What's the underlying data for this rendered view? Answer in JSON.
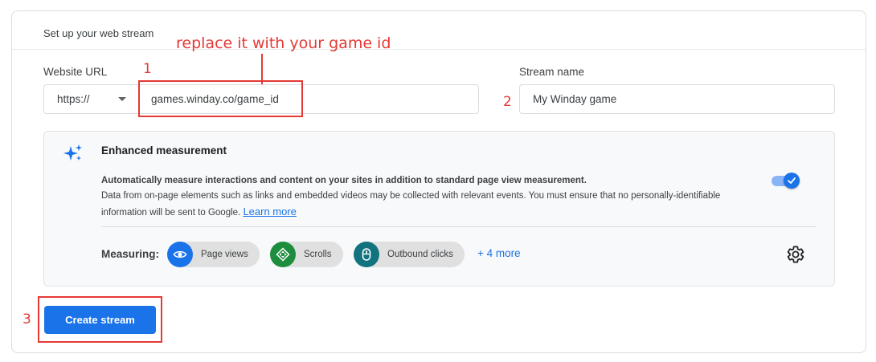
{
  "card": {
    "title": "Set up your web stream"
  },
  "annotations": {
    "instruction": "replace it with your game id",
    "step1": "1",
    "step2": "2",
    "step3": "3"
  },
  "form": {
    "website_url_label": "Website URL",
    "protocol_value": "https://",
    "url_value": "games.winday.co/game_id",
    "stream_name_label": "Stream name",
    "stream_name_value": "My Winday game"
  },
  "enhanced_measurement": {
    "title": "Enhanced measurement",
    "description_primary": "Automatically measure interactions and content on your sites in addition to standard page view measurement.",
    "description_secondary": "Data from on-page elements such as links and embedded videos may be collected with relevant events. You must ensure that no personally-identifiable information will be sent to Google.",
    "learn_more": "Learn more",
    "toggle_on": true,
    "measuring_label": "Measuring:",
    "chips": [
      {
        "label": "Page views",
        "icon": "eye-icon",
        "color": "#1a73e8"
      },
      {
        "label": "Scrolls",
        "icon": "scroll-arrows-icon",
        "color": "#1e8e3e"
      },
      {
        "label": "Outbound clicks",
        "icon": "mouse-icon",
        "color": "#12737f"
      }
    ],
    "more_link": "+ 4 more",
    "settings_icon": "gear-icon"
  },
  "actions": {
    "create_stream": "Create stream"
  },
  "colors": {
    "accent": "#1a73e8",
    "annotation": "#e53935"
  }
}
